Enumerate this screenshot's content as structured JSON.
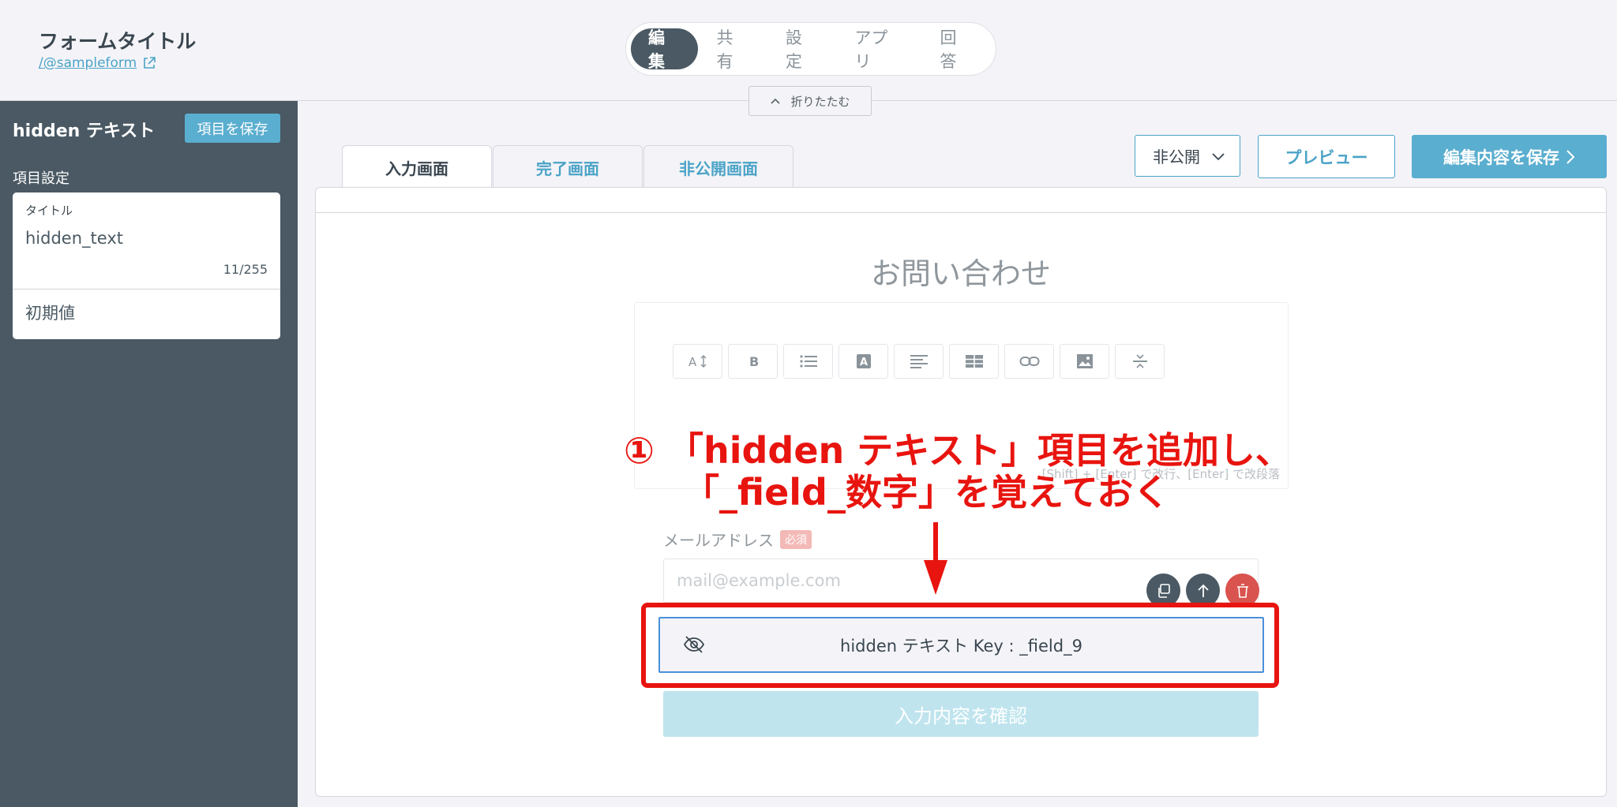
{
  "header": {
    "form_title": "フォームタイトル",
    "form_link": "/@sampleform",
    "nav": [
      "編集",
      "共有",
      "設定",
      "アプリ",
      "回答"
    ],
    "collapse_label": "折りたたむ"
  },
  "sidebar": {
    "title": "hidden テキスト",
    "save_label": "項目を保存",
    "section_label": "項目設定",
    "field_title_label": "タイトル",
    "field_title_value": "hidden_text",
    "field_title_count": "11/255",
    "initial_value_label": "初期値"
  },
  "tabs": [
    "入力画面",
    "完了画面",
    "非公開画面"
  ],
  "toolbar": {
    "visibility_value": "非公開",
    "preview_label": "プレビュー",
    "save_all_label": "編集内容を保存"
  },
  "form": {
    "heading": "お問い合わせ",
    "editor_hint": "[Shift] + [Enter] で改行、[Enter] で改段落",
    "editor_tools": [
      "font-size-icon",
      "bold-icon",
      "list-icon",
      "text-color-icon",
      "align-icon",
      "table-icon",
      "link-icon",
      "image-icon",
      "divider-icon"
    ],
    "email_label": "メールアドレス",
    "required_badge": "必須",
    "email_placeholder": "mail@example.com",
    "hidden_field_text": "hidden テキスト Key : _field_9",
    "confirm_label": "入力内容を確認"
  },
  "annotation": {
    "line1": "① 「hidden テキスト」項目を追加し、",
    "line2": "「_field_数字」を覚えておく"
  },
  "colors": {
    "accent": "#5aaecf",
    "sidebar": "#4a5963",
    "annotation": "#e8140f",
    "delete": "#d9534f"
  }
}
